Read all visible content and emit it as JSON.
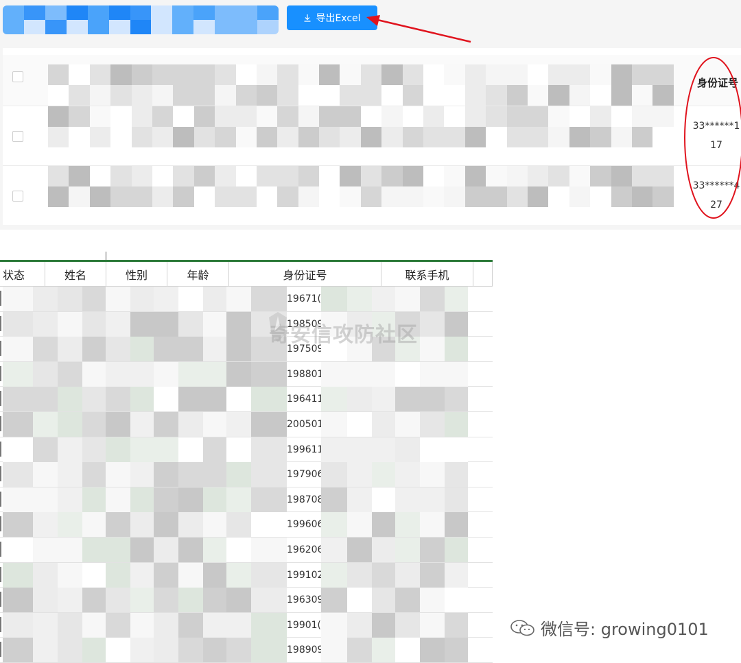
{
  "toolbar": {
    "export_label": "导出Excel",
    "export_icon": "download-icon",
    "accent": "#1890ff"
  },
  "admin_table": {
    "id_column_header": "身份证号",
    "rows": [
      {
        "id_line1": "33******1",
        "id_line2": "17"
      },
      {
        "id_line1": "33******4",
        "id_line2": "27"
      }
    ],
    "highlight_color": "#e0141e"
  },
  "spreadsheet": {
    "headers": [
      "状态",
      "姓名",
      "性别",
      "年龄",
      "身份证号",
      "联系手机"
    ],
    "id_prefixes": [
      "19671(",
      "198509",
      "197509",
      "198801",
      "196411",
      "200501",
      "199611",
      "197906",
      "198708",
      "199606",
      "196206",
      "199102",
      "196309",
      "19901(",
      "198909"
    ],
    "header_rule_color": "#2c7a3a"
  },
  "watermark": {
    "text": "奇安信攻防社区"
  },
  "footer_credit": {
    "text": "微信号: growing0101",
    "icon": "wechat-icon"
  }
}
